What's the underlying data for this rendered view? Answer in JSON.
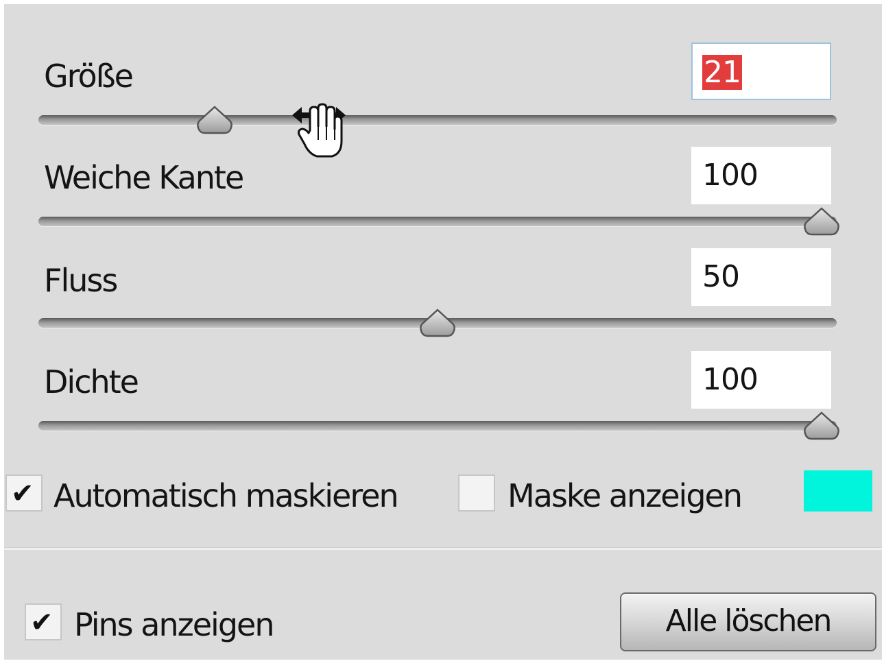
{
  "sliders": [
    {
      "label": "Größe",
      "value": "21",
      "value_selected": true,
      "position_percent": 21
    },
    {
      "label": "Weiche Kante",
      "value": "100",
      "value_selected": false,
      "position_percent": 100
    },
    {
      "label": "Fluss",
      "value": "50",
      "value_selected": false,
      "position_percent": 50
    },
    {
      "label": "Dichte",
      "value": "100",
      "value_selected": false,
      "position_percent": 100
    }
  ],
  "options": {
    "auto_mask": {
      "label": "Automatisch maskieren",
      "checked": true
    },
    "show_mask": {
      "label": "Maske anzeigen",
      "checked": false
    },
    "mask_color": "#00f5dc"
  },
  "footer": {
    "pins": {
      "label": "Pins anzeigen",
      "checked": true
    },
    "clear_all_label": "Alle löschen"
  },
  "cursor": {
    "icon": "hand-resize-cursor-icon"
  },
  "glyphs": {
    "check": "✔"
  }
}
